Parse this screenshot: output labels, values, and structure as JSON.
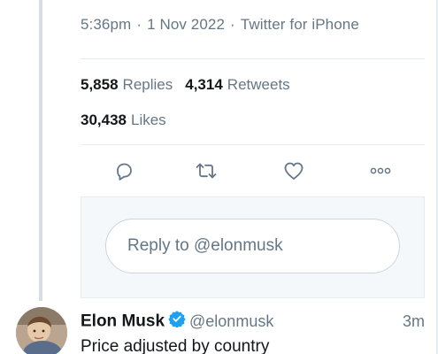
{
  "tweet_meta": {
    "time": "5:36pm",
    "date": "1 Nov 2022",
    "source": "Twitter for iPhone",
    "separator": "·"
  },
  "stats": {
    "replies_count": "5,858",
    "replies_label": "Replies",
    "retweets_count": "4,314",
    "retweets_label": "Retweets",
    "likes_count": "30,438",
    "likes_label": "Likes"
  },
  "actions": [
    {
      "icon": "reply-icon"
    },
    {
      "icon": "retweet-icon"
    },
    {
      "icon": "like-icon"
    },
    {
      "icon": "more-icon"
    }
  ],
  "reply": {
    "placeholder": "Reply to @elonmusk"
  },
  "reply_tweet": {
    "author_name": "Elon Musk",
    "verified_icon": "verified-badge-icon",
    "handle": "@elonmusk",
    "time_ago": "3m",
    "text": "Price adjusted by country"
  },
  "colors": {
    "text_primary": "#14171a",
    "text_secondary": "#657786",
    "icon": "#657786",
    "verified": "#1da1f2",
    "border": "#e6ecf0",
    "reply_bg": "#f5f8fa"
  }
}
